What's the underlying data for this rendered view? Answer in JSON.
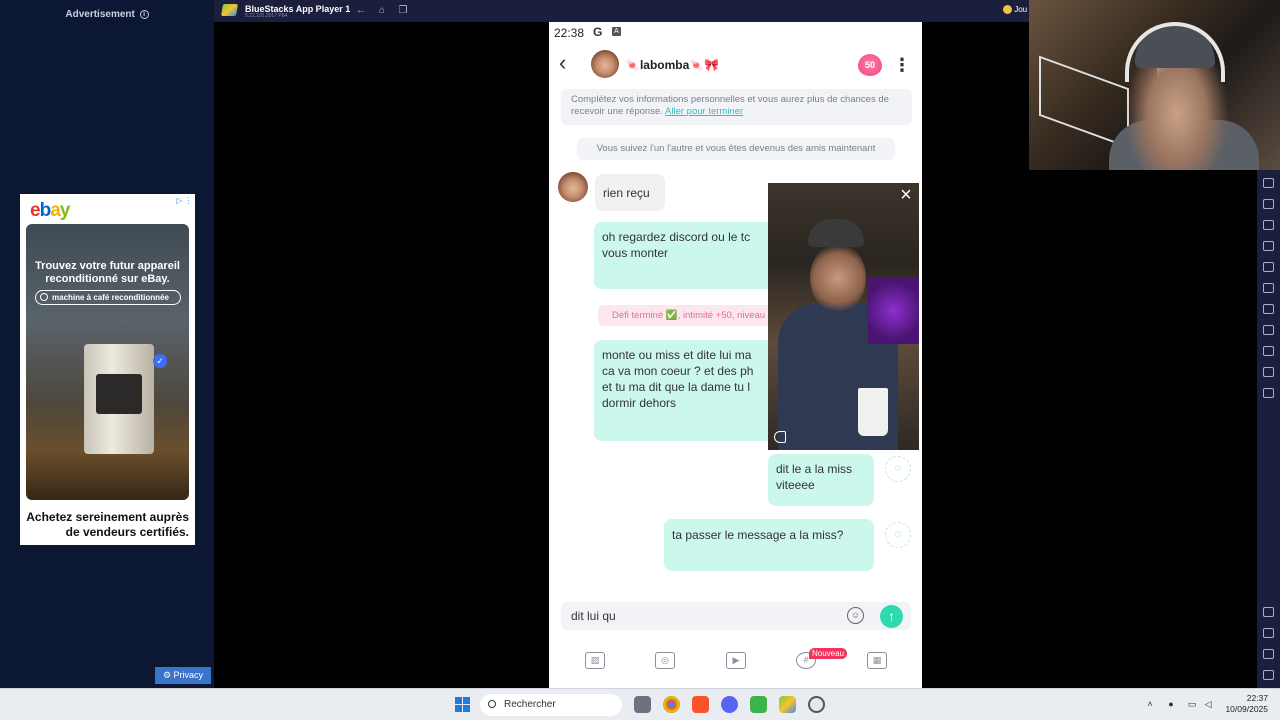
{
  "ad": {
    "label": "Advertisement",
    "brand_letters": [
      "e",
      "b",
      "a",
      "y"
    ],
    "headline": "Trouvez votre futur appareil reconditionné sur eBay.",
    "search_chip": "machine à café reconditionnée",
    "footer": "Achetez sereinement auprès de vendeurs certifiés.",
    "privacy": "Privacy"
  },
  "bluestacks": {
    "title": "BlueStacks App Player 1",
    "version": "5.22.101.2017 P64",
    "user_label": "Jou"
  },
  "phone": {
    "status_time": "22:38",
    "status_g": "G",
    "status_a": "A",
    "contact_name": "🍬labomba🍬🎀",
    "intimacy": "50",
    "profile_notice": "Complétez vos informations personnelles et vous aurez plus de chances de recevoir une réponse. ",
    "profile_link": "Aller pour terminer",
    "friends_notice": "Vous suivez l'un l'autre et vous êtes devenus des amis maintenant",
    "messages": [
      {
        "text": "rien reçu",
        "from": "them"
      },
      {
        "text": "oh regardez discord ou le tc vous monter",
        "from": "me"
      },
      {
        "text": "monte ou miss et dite lui ma ca va mon coeur ? et des ph et tu ma dit que la dame tu l dormir dehors",
        "from": "me"
      },
      {
        "text": "dit le a la miss viteeee",
        "from": "me"
      },
      {
        "text": "ta passer le message a la miss?",
        "from": "me"
      }
    ],
    "challenge": "Défi terminé ✅, intimité +50, niveau",
    "input_value": "dit lui qu",
    "nouveau": "Nouveau"
  },
  "taskbar": {
    "search": "Rechercher",
    "time": "22:37",
    "date": "10/09/2025"
  }
}
